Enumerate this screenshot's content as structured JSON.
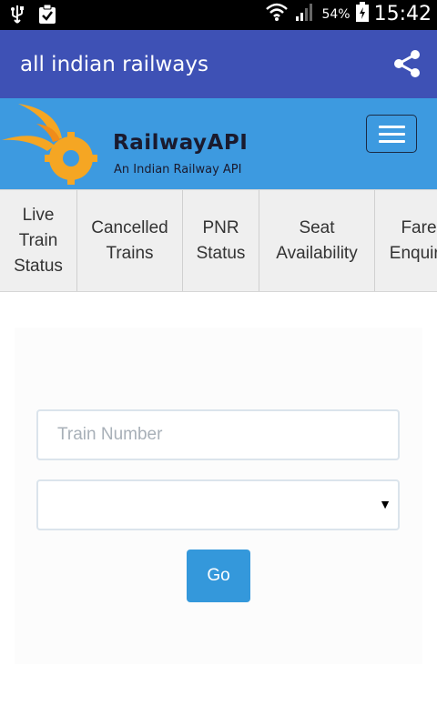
{
  "status_bar": {
    "battery_percent": "54%",
    "time": "15:42",
    "icons": [
      "usb-icon",
      "clipboard-check-icon",
      "wifi-icon",
      "signal-icon",
      "battery-charging-icon"
    ]
  },
  "app_bar": {
    "title": "all indian railways",
    "share_icon": "share-icon",
    "color": "#3e51b5"
  },
  "header": {
    "logo_title": "RailwayAPI",
    "logo_subtitle": "An Indian Railway API",
    "menu_icon": "hamburger-menu-icon",
    "color": "#3d9ae0"
  },
  "tabs": [
    {
      "label": "Live\nTrain\nStatus"
    },
    {
      "label": "Cancelled\nTrains"
    },
    {
      "label": "PNR\nStatus"
    },
    {
      "label": "Seat\nAvailability"
    },
    {
      "label": "Fare\nEnquiry"
    }
  ],
  "form": {
    "train_number_placeholder": "Train Number",
    "select_value": "",
    "go_label": "Go",
    "go_color": "#3498db"
  }
}
